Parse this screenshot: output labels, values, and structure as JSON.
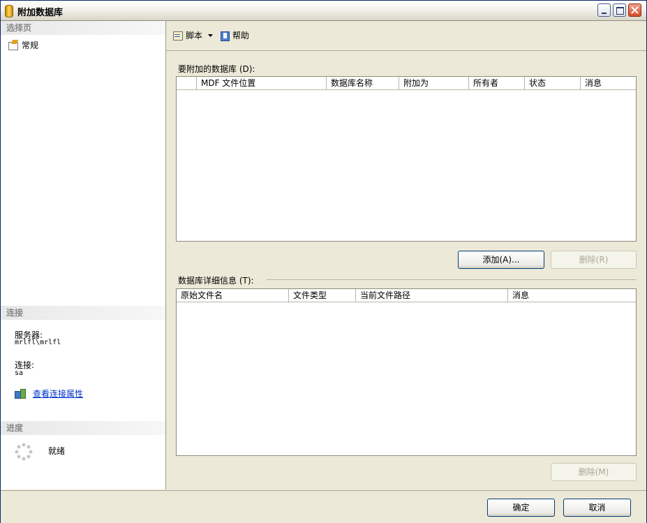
{
  "window": {
    "title": "附加数据库"
  },
  "left_pane": {
    "select_page_header": "选择页",
    "pages": [
      {
        "label": "常规"
      }
    ],
    "connection_header": "连接",
    "server_label": "服务器:",
    "server_value": "mrlfl\\mrlfl",
    "connection_label": "连接:",
    "connection_value": "sa",
    "view_connection_properties": "查看连接属性",
    "progress_header": "进度",
    "progress_status": "就绪"
  },
  "toolbar": {
    "script_label": "脚本",
    "help_label": "帮助"
  },
  "attach_section": {
    "label": "要附加的数据库 (D):",
    "columns": [
      "MDF 文件位置",
      "数据库名称",
      "附加为",
      "所有者",
      "状态",
      "消息"
    ],
    "rows": [],
    "add_button": "添加(A)...",
    "remove_button": "删除(R)"
  },
  "details_section": {
    "label": "数据库详细信息 (T):",
    "columns": [
      "原始文件名",
      "文件类型",
      "当前文件路径",
      "消息"
    ],
    "rows": [],
    "remove_button": "删除(M)"
  },
  "footer": {
    "ok_button": "确定",
    "cancel_button": "取消"
  }
}
